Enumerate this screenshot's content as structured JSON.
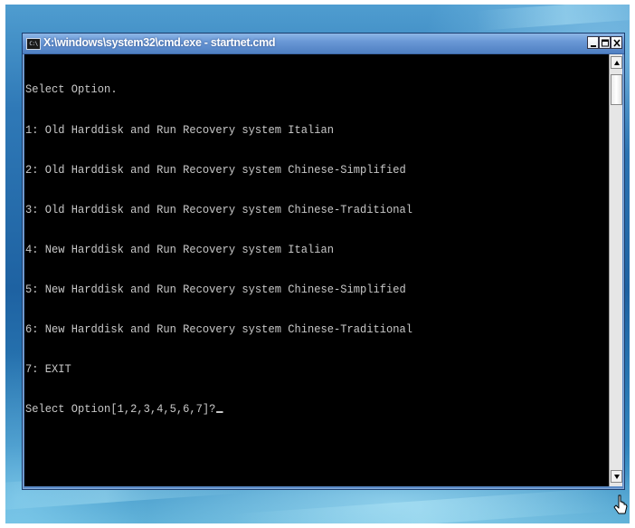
{
  "window": {
    "title": "X:\\windows\\system32\\cmd.exe - startnet.cmd",
    "app_icon_text": "C:\\",
    "controls": [
      "minimize",
      "maximize",
      "close"
    ]
  },
  "console": {
    "lines": [
      "Select Option.",
      "1: Old Harddisk and Run Recovery system Italian",
      "2: Old Harddisk and Run Recovery system Chinese-Simplified",
      "3: Old Harddisk and Run Recovery system Chinese-Traditional",
      "4: New Harddisk and Run Recovery system Italian",
      "5: New Harddisk and Run Recovery system Chinese-Simplified",
      "6: New Harddisk and Run Recovery system Chinese-Traditional",
      "7: EXIT"
    ],
    "prompt": "Select Option[1,2,3,4,5,6,7]?",
    "input_value": ""
  },
  "icons": {
    "app": "cmd-icon",
    "minimize": "minimize-icon",
    "maximize": "maximize-icon",
    "close": "close-icon",
    "scroll_up": "scroll-up-arrow-icon",
    "scroll_down": "scroll-down-arrow-icon",
    "pointer": "mouse-pointer-icon"
  },
  "colors": {
    "console_background": "#000000",
    "console_text": "#c8c8c8",
    "titlebar": "#6a98d6"
  }
}
